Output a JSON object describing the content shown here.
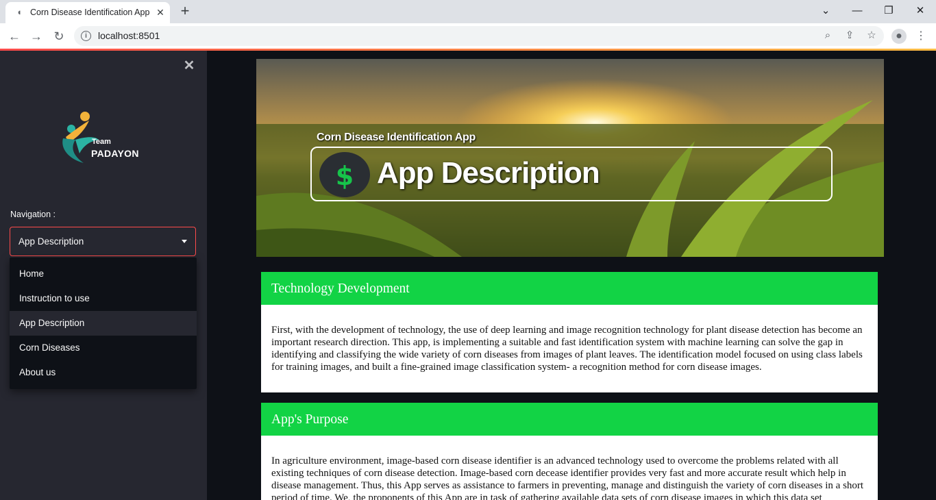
{
  "browser": {
    "tab_title": "Corn Disease Identification App",
    "tab_close": "✕",
    "new_tab": "+",
    "url": "localhost:8501",
    "window_controls": [
      "minimize",
      "restore",
      "close"
    ]
  },
  "sidebar": {
    "close": "✕",
    "logo": {
      "team": "Team",
      "name": "PADAYON"
    },
    "nav_label": "Navigation :",
    "selected": "App Description",
    "options": [
      "Home",
      "Instruction to use",
      "App Description",
      "Corn Diseases",
      "About us"
    ]
  },
  "banner": {
    "subtitle": "Corn Disease Identification App",
    "title": "App Description"
  },
  "sections": [
    {
      "title": "Technology Development",
      "body": "First, with the development of technology, the use of deep learning and image recognition technology for plant disease detection has become an important research direction. This app, is implementing a suitable and fast identification system with machine learning can solve the gap in identifying and classifying the wide variety of corn diseases from images of plant leaves. The identification model focused on using class labels for training images, and built a fine-grained image classification system- a recognition method for corn disease images."
    },
    {
      "title": "App's Purpose",
      "body": "In agriculture environment, image-based corn disease identifier is an advanced technology used to overcome the problems related with all existing techniques of corn disease detection. Image-based corn decease identifier provides very fast and more accurate result which help in disease management. Thus, this App serves as assistance to farmers in preventing, manage and distinguish the variety of corn diseases in a short period of time. We, the proponents of this App are in task of gathering available data sets of corn disease images in which this data set"
    }
  ],
  "colors": {
    "accent": "#12d345",
    "sidebar_bg": "#262730",
    "main_bg": "#0e1117",
    "select_border": "#ff4b4b"
  }
}
